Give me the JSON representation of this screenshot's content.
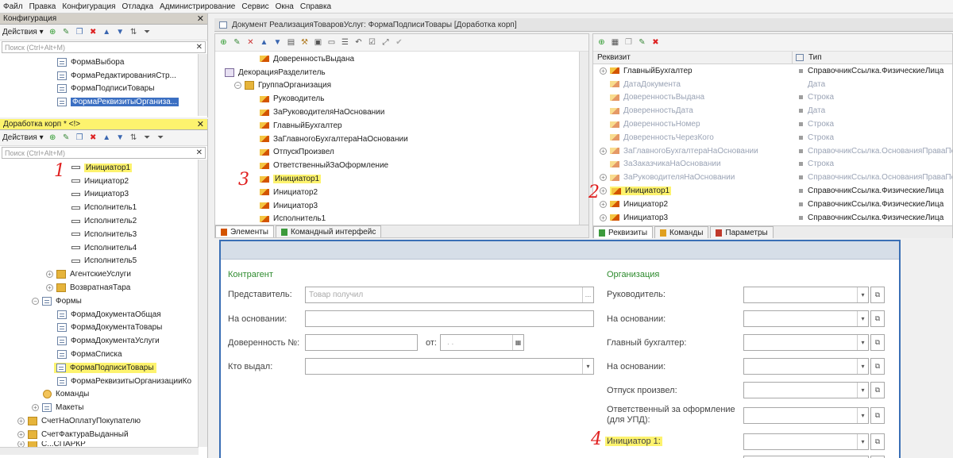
{
  "menu": [
    "Файл",
    "Правка",
    "Конфигурация",
    "Отладка",
    "Администрирование",
    "Сервис",
    "Окна",
    "Справка"
  ],
  "config_panel": {
    "title": "Конфигурация",
    "actions_label": "Действия",
    "search_placeholder": "Поиск (Ctrl+Alt+M)",
    "items": [
      "ФормаВыбора",
      "ФормаРедактированияСтр...",
      "ФормаПодписиТовары",
      "ФормаРеквизитыОрганиза..."
    ]
  },
  "ext_panel": {
    "title": "Доработка корп * <!>",
    "actions_label": "Действия",
    "search_placeholder": "Поиск (Ctrl+Alt+M)",
    "attr_items": [
      "Инициатор1",
      "Инициатор2",
      "Инициатор3",
      "Исполнитель1",
      "Исполнитель2",
      "Исполнитель3",
      "Исполнитель4",
      "Исполнитель5"
    ],
    "folders": [
      "АгентскиеУслуги",
      "ВозвратнаяТара",
      "Формы"
    ],
    "forms": [
      "ФормаДокументаОбщая",
      "ФормаДокументаТовары",
      "ФормаДокументаУслуги",
      "ФормаСписка",
      "ФормаПодписиТовары",
      "ФормаРеквизитыОрганизацииКо"
    ],
    "tail": [
      "Команды",
      "Макеты",
      "СчетНаОплатуПокупателю",
      "СчетФактураВыданный",
      "С...СПАРКР"
    ]
  },
  "doc_window": {
    "title": "Документ РеализацияТоваровУслуг: ФормаПодписиТовары [Доработка корп]",
    "elements": [
      "ДоверенностьВыдана",
      "ДекорацияРазделитель",
      "ГруппаОрганизация",
      "Руководитель",
      "ЗаРуководителяНаОсновании",
      "ГлавныйБухгалтер",
      "ЗаГлавногоБухгалтераНаОсновании",
      "ОтпускПроизвел",
      "ОтветственныйЗаОформление",
      "Инициатор1",
      "Инициатор2",
      "Инициатор3",
      "Исполнитель1"
    ],
    "tabs_left": [
      "Элементы",
      "Командный интерфейс"
    ],
    "props_head": [
      "Реквизит",
      "Тип"
    ],
    "props": [
      {
        "name": "ГлавныйБухгалтер",
        "type": "СправочникСсылка.ФизическиеЛица",
        "gray": false
      },
      {
        "name": "ДатаДокумента",
        "type": "Дата",
        "gray": true
      },
      {
        "name": "ДоверенностьВыдана",
        "type": "Строка",
        "gray": true
      },
      {
        "name": "ДоверенностьДата",
        "type": "Дата",
        "gray": true
      },
      {
        "name": "ДоверенностьНомер",
        "type": "Строка",
        "gray": true
      },
      {
        "name": "ДоверенностьЧерезКого",
        "type": "Строка",
        "gray": true
      },
      {
        "name": "ЗаГлавногоБухгалтераНаОсновании",
        "type": "СправочникСсылка.ОснованияПраваПо",
        "gray": true
      },
      {
        "name": "ЗаЗаказчикаНаОсновании",
        "type": "Строка",
        "gray": true
      },
      {
        "name": "ЗаРуководителяНаОсновании",
        "type": "СправочникСсылка.ОснованияПраваПо",
        "gray": true
      },
      {
        "name": "Инициатор1",
        "type": "СправочникСсылка.ФизическиеЛица",
        "gray": false
      },
      {
        "name": "Инициатор2",
        "type": "СправочникСсылка.ФизическиеЛица",
        "gray": false
      },
      {
        "name": "Инициатор3",
        "type": "СправочникСсылка.ФизическиеЛица",
        "gray": false
      }
    ],
    "tabs_right": [
      "Реквизиты",
      "Команды",
      "Параметры"
    ]
  },
  "form_preview": {
    "left_section": "Контрагент",
    "right_section": "Организация",
    "left_labels": [
      "Представитель:",
      "На основании:",
      "Доверенность №:",
      "Кто выдал:"
    ],
    "representative_placeholder": "Товар получил",
    "date_label": "от:",
    "date_placeholder": ". .",
    "right_labels": [
      "Руководитель:",
      "На основании:",
      "Главный бухгалтер:",
      "На основании:",
      "Отпуск произвел:",
      "Ответственный за оформление (для УПД):",
      "Инициатор 1:"
    ]
  },
  "annotations": [
    "1",
    "2",
    "3",
    "4"
  ]
}
